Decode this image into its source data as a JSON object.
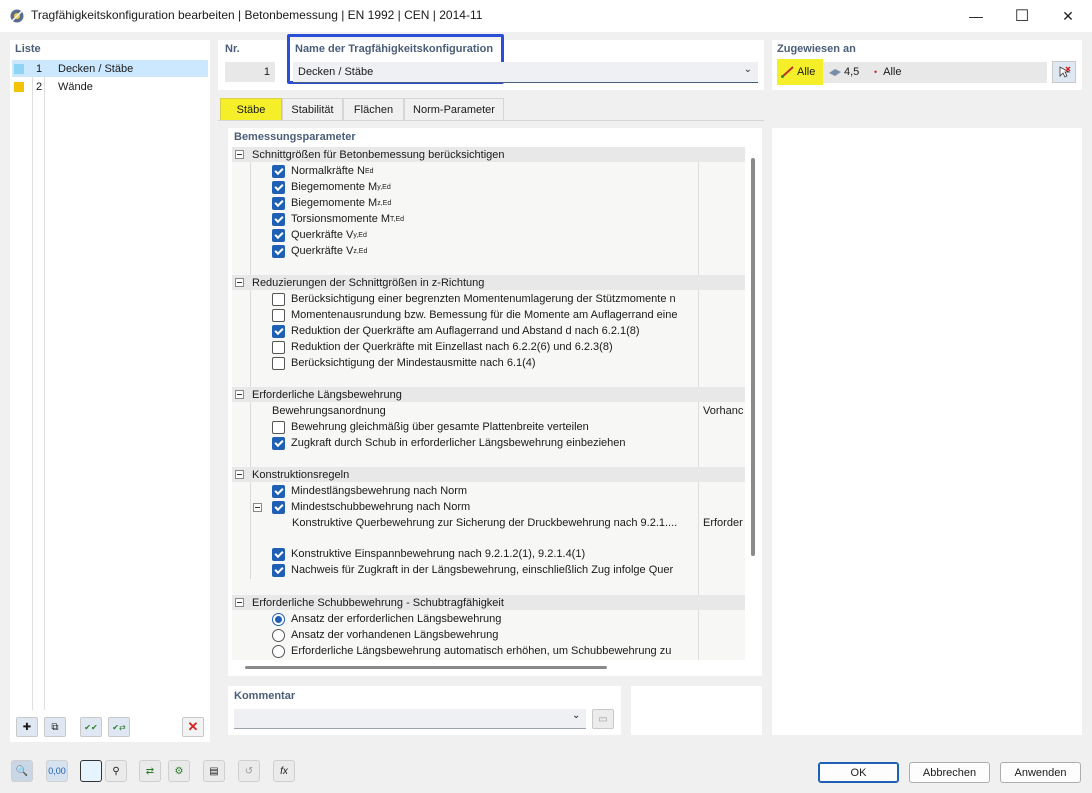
{
  "window": {
    "title": "Tragfähigkeitskonfiguration bearbeiten | Betonbemessung | EN 1992 | CEN | 2014-11",
    "minimize": "—",
    "maximize": "☐",
    "close": "✕"
  },
  "list": {
    "header": "Liste",
    "items": [
      {
        "num": "1",
        "label": "Decken / Stäbe",
        "color": "#8fd3f5"
      },
      {
        "num": "2",
        "label": "Wände",
        "color": "#f3c200"
      }
    ]
  },
  "nr": {
    "header": "Nr.",
    "value": "1"
  },
  "name": {
    "header": "Name der Tragfähigkeitskonfiguration",
    "value": "Decken / Stäbe"
  },
  "assigned": {
    "header": "Zugewiesen an",
    "members": "Alle",
    "thickness": "4,5",
    "nodes": "Alle"
  },
  "tabs": [
    "Stäbe",
    "Stabilität",
    "Flächen",
    "Norm-Parameter"
  ],
  "params": {
    "header": "Bemessungsparameter",
    "g1": {
      "title": "Schnittgrößen für Betonbemessung berücksichtigen",
      "r1": "Normalkräfte N",
      "r1s": "Ed",
      "r2": "Biegemomente M",
      "r2s": "y,Ed",
      "r3": "Biegemomente M",
      "r3s": "z,Ed",
      "r4": "Torsionsmomente M",
      "r4s": "T,Ed",
      "r5": "Querkräfte V",
      "r5s": "y,Ed",
      "r6": "Querkräfte V",
      "r6s": "z,Ed"
    },
    "g2": {
      "title": "Reduzierungen der Schnittgrößen in z-Richtung",
      "r1": "Berücksichtigung einer begrenzten Momentenumlagerung der Stützmomente n",
      "r2": "Momentenausrundung bzw. Bemessung für die Momente am Auflagerrand eine",
      "r3": "Reduktion der Querkräfte am Auflagerrand und Abstand d nach 6.2.1(8)",
      "r4": "Reduktion der Querkräfte mit Einzellast nach 6.2.2(6) und 6.2.3(8)",
      "r5": "Berücksichtigung der Mindestausmitte nach 6.1(4)"
    },
    "g3": {
      "title": "Erforderliche Längsbewehrung",
      "r1": "Bewehrungsanordnung",
      "r1v": "Vorhanc",
      "r2": "Bewehrung gleichmäßig über gesamte Plattenbreite verteilen",
      "r3": "Zugkraft durch Schub in erforderlicher Längsbewehrung einbeziehen"
    },
    "g4": {
      "title": "Konstruktionsregeln",
      "r1": "Mindestlängsbewehrung nach Norm",
      "r2": "Mindestschubbewehrung nach Norm",
      "r3": "Konstruktive Querbewehrung zur Sicherung der Druckbewehrung nach 9.2.1....",
      "r3v": "Erforder",
      "r4": "Konstruktive Einspannbewehrung nach 9.2.1.2(1), 9.2.1.4(1)",
      "r5": "Nachweis für Zugkraft in der Längsbewehrung, einschließlich Zug infolge Quer"
    },
    "g5": {
      "title": "Erforderliche Schubbewehrung - Schubtragfähigkeit",
      "r1": "Ansatz der erforderlichen Längsbewehrung",
      "r2": "Ansatz der vorhandenen Längsbewehrung",
      "r3": "Erforderliche Längsbewehrung automatisch erhöhen, um Schubbewehrung zu"
    }
  },
  "comment": {
    "header": "Kommentar",
    "value": ""
  },
  "toolbar_left": {
    "b1": "✚",
    "b2": "⧉",
    "b3": "✔✔",
    "b4": "✔⇄",
    "b5": "✕"
  },
  "bottom_icons": {
    "i1": "🔍",
    "i2": "0,00",
    "i3": "",
    "i4": "⚲",
    "i5": "⇄",
    "i6": "⚙",
    "i7": "▤",
    "i8": "↺",
    "i9": "fx"
  },
  "buttons": {
    "ok": "OK",
    "cancel": "Abbrechen",
    "apply": "Anwenden"
  },
  "colors": {
    "accent": "#1f5fb4",
    "selected_tab": "#f5ef2a",
    "highlight_box": "#2a4fd6",
    "selected_row": "#cce8ff"
  }
}
